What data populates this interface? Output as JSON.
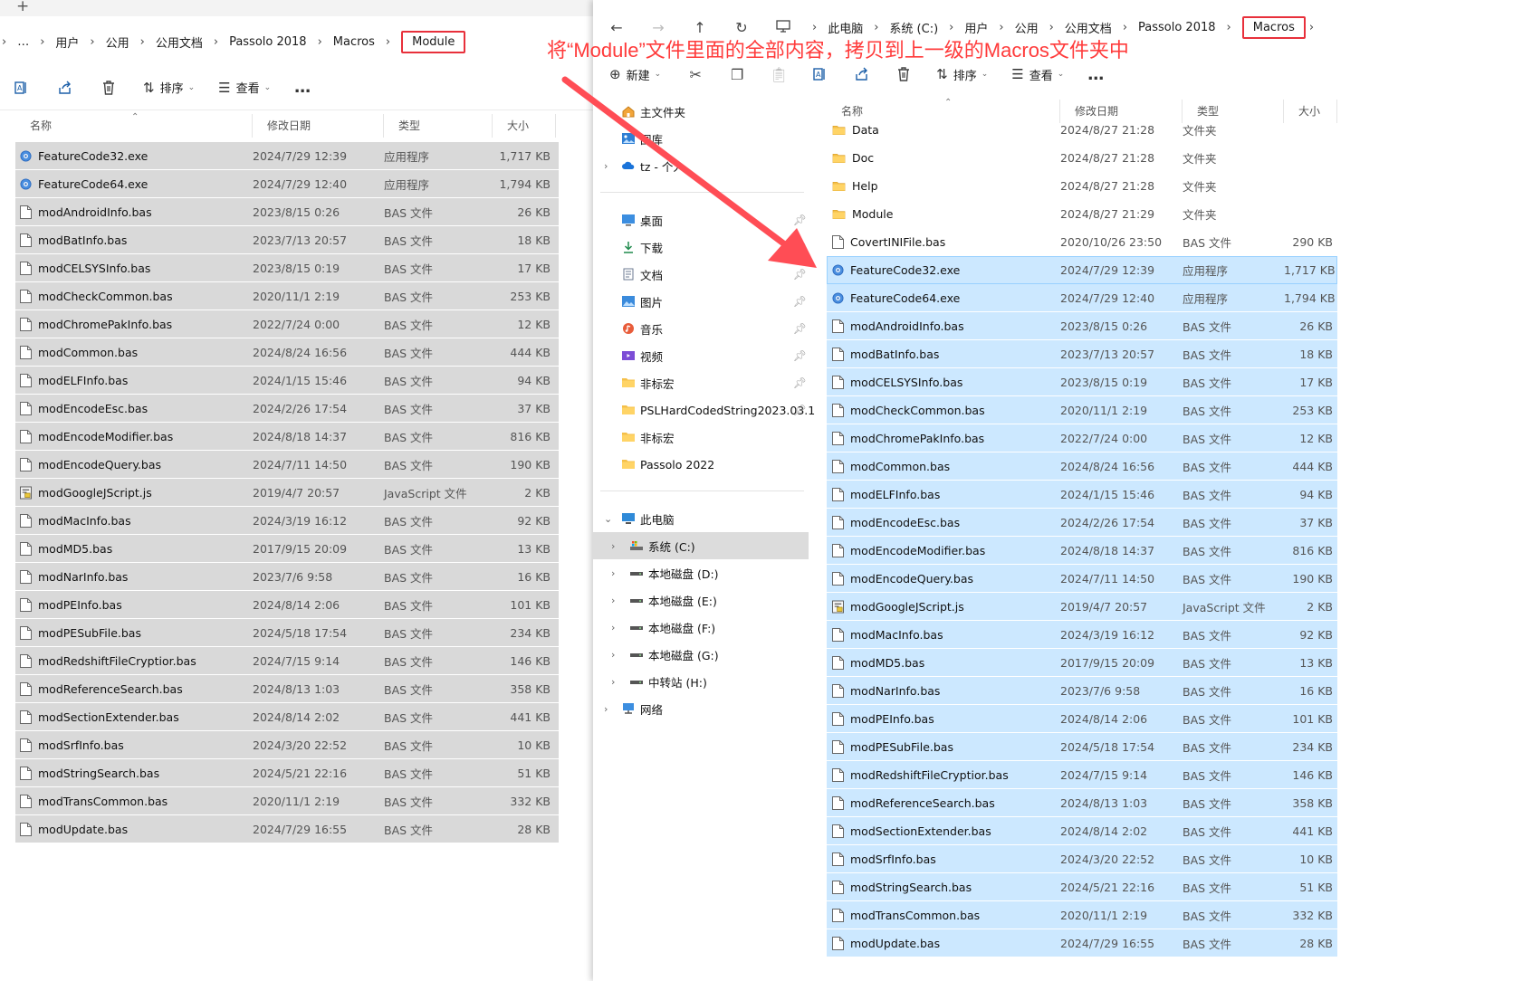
{
  "annotation": {
    "text": "将“Module”文件里面的全部内容，拷贝到上一级的Macros文件夹中",
    "color": "#ff3b3b"
  },
  "left": {
    "tab_plus": "+",
    "breadcrumb": {
      "more": "…",
      "items": [
        "用户",
        "公用",
        "公用文档",
        "Passolo 2018",
        "Macros"
      ],
      "current": "Module"
    },
    "toolbar": {
      "sort": "排序",
      "view": "查看",
      "more": "…"
    },
    "columns": {
      "name": "名称",
      "date": "修改日期",
      "type": "类型",
      "size": "大小"
    },
    "files": [
      {
        "name": "FeatureCode32.exe",
        "date": "2024/7/29 12:39",
        "type": "应用程序",
        "size": "1,717 KB",
        "icon": "exe-icon"
      },
      {
        "name": "FeatureCode64.exe",
        "date": "2024/7/29 12:40",
        "type": "应用程序",
        "size": "1,794 KB",
        "icon": "exe-icon"
      },
      {
        "name": "modAndroidInfo.bas",
        "date": "2023/8/15 0:26",
        "type": "BAS 文件",
        "size": "26 KB",
        "icon": "file-icon"
      },
      {
        "name": "modBatInfo.bas",
        "date": "2023/7/13 20:57",
        "type": "BAS 文件",
        "size": "18 KB",
        "icon": "file-icon"
      },
      {
        "name": "modCELSYSInfo.bas",
        "date": "2023/8/15 0:19",
        "type": "BAS 文件",
        "size": "17 KB",
        "icon": "file-icon"
      },
      {
        "name": "modCheckCommon.bas",
        "date": "2020/11/1 2:19",
        "type": "BAS 文件",
        "size": "253 KB",
        "icon": "file-icon"
      },
      {
        "name": "modChromePakInfo.bas",
        "date": "2022/7/24 0:00",
        "type": "BAS 文件",
        "size": "12 KB",
        "icon": "file-icon"
      },
      {
        "name": "modCommon.bas",
        "date": "2024/8/24 16:56",
        "type": "BAS 文件",
        "size": "444 KB",
        "icon": "file-icon"
      },
      {
        "name": "modELFInfo.bas",
        "date": "2024/1/15 15:46",
        "type": "BAS 文件",
        "size": "94 KB",
        "icon": "file-icon"
      },
      {
        "name": "modEncodeEsc.bas",
        "date": "2024/2/26 17:54",
        "type": "BAS 文件",
        "size": "37 KB",
        "icon": "file-icon"
      },
      {
        "name": "modEncodeModifier.bas",
        "date": "2024/8/18 14:37",
        "type": "BAS 文件",
        "size": "816 KB",
        "icon": "file-icon"
      },
      {
        "name": "modEncodeQuery.bas",
        "date": "2024/7/11 14:50",
        "type": "BAS 文件",
        "size": "190 KB",
        "icon": "file-icon"
      },
      {
        "name": "modGoogleJScript.js",
        "date": "2019/4/7 20:57",
        "type": "JavaScript 文件",
        "size": "2 KB",
        "icon": "js-icon"
      },
      {
        "name": "modMacInfo.bas",
        "date": "2024/3/19 16:12",
        "type": "BAS 文件",
        "size": "92 KB",
        "icon": "file-icon"
      },
      {
        "name": "modMD5.bas",
        "date": "2017/9/15 20:09",
        "type": "BAS 文件",
        "size": "13 KB",
        "icon": "file-icon"
      },
      {
        "name": "modNarInfo.bas",
        "date": "2023/7/6 9:58",
        "type": "BAS 文件",
        "size": "16 KB",
        "icon": "file-icon"
      },
      {
        "name": "modPEInfo.bas",
        "date": "2024/8/14 2:06",
        "type": "BAS 文件",
        "size": "101 KB",
        "icon": "file-icon"
      },
      {
        "name": "modPESubFile.bas",
        "date": "2024/5/18 17:54",
        "type": "BAS 文件",
        "size": "234 KB",
        "icon": "file-icon"
      },
      {
        "name": "modRedshiftFileCryptior.bas",
        "date": "2024/7/15 9:14",
        "type": "BAS 文件",
        "size": "146 KB",
        "icon": "file-icon"
      },
      {
        "name": "modReferenceSearch.bas",
        "date": "2024/8/13 1:03",
        "type": "BAS 文件",
        "size": "358 KB",
        "icon": "file-icon"
      },
      {
        "name": "modSectionExtender.bas",
        "date": "2024/8/14 2:02",
        "type": "BAS 文件",
        "size": "441 KB",
        "icon": "file-icon"
      },
      {
        "name": "modSrfInfo.bas",
        "date": "2024/3/20 22:52",
        "type": "BAS 文件",
        "size": "10 KB",
        "icon": "file-icon"
      },
      {
        "name": "modStringSearch.bas",
        "date": "2024/5/21 22:16",
        "type": "BAS 文件",
        "size": "51 KB",
        "icon": "file-icon"
      },
      {
        "name": "modTransCommon.bas",
        "date": "2020/11/1 2:19",
        "type": "BAS 文件",
        "size": "332 KB",
        "icon": "file-icon"
      },
      {
        "name": "modUpdate.bas",
        "date": "2024/7/29 16:55",
        "type": "BAS 文件",
        "size": "28 KB",
        "icon": "file-icon"
      }
    ]
  },
  "right": {
    "breadcrumb": {
      "items": [
        "此电脑",
        "系统 (C:)",
        "用户",
        "公用",
        "公用文档",
        "Passolo 2018"
      ],
      "current": "Macros"
    },
    "toolbar": {
      "new": "新建",
      "sort": "排序",
      "view": "查看",
      "more": "…"
    },
    "columns": {
      "name": "名称",
      "date": "修改日期",
      "type": "类型",
      "size": "大小"
    },
    "nav": {
      "quick": [
        {
          "label": "主文件夹",
          "icon": "home-icon",
          "chevron": false
        },
        {
          "label": "图库",
          "icon": "gallery-icon",
          "chevron": false
        },
        {
          "label": "tz - 个人",
          "icon": "cloud-icon",
          "chevron": true
        }
      ],
      "pinned": [
        {
          "label": "桌面",
          "icon": "desktop-icon",
          "pin": true
        },
        {
          "label": "下载",
          "icon": "download-icon",
          "pin": true
        },
        {
          "label": "文档",
          "icon": "document-icon",
          "pin": true
        },
        {
          "label": "图片",
          "icon": "picture-icon",
          "pin": true
        },
        {
          "label": "音乐",
          "icon": "music-icon",
          "pin": true
        },
        {
          "label": "视频",
          "icon": "video-icon",
          "pin": true
        },
        {
          "label": "非标宏",
          "icon": "folder-icon",
          "pin": true
        },
        {
          "label": "PSLHardCodedString2023.03.1",
          "icon": "folder-icon",
          "pin": true
        },
        {
          "label": "非标宏",
          "icon": "folder-icon",
          "pin": false
        },
        {
          "label": "Passolo 2022",
          "icon": "folder-icon",
          "pin": false
        }
      ],
      "pc": {
        "label": "此电脑",
        "icon": "pc-icon"
      },
      "drives": [
        {
          "label": "系统 (C:)",
          "icon": "system-drive-icon",
          "selected": true
        },
        {
          "label": "本地磁盘 (D:)",
          "icon": "drive-icon",
          "selected": false
        },
        {
          "label": "本地磁盘 (E:)",
          "icon": "drive-icon",
          "selected": false
        },
        {
          "label": "本地磁盘 (F:)",
          "icon": "drive-icon",
          "selected": false
        },
        {
          "label": "本地磁盘 (G:)",
          "icon": "drive-icon",
          "selected": false
        },
        {
          "label": "中转站 (H:)",
          "icon": "drive-icon",
          "selected": false
        }
      ],
      "network": {
        "label": "网络",
        "icon": "network-icon"
      }
    },
    "files": [
      {
        "name": "Data",
        "date": "2024/8/27 21:28",
        "type": "文件夹",
        "size": "",
        "icon": "folder-icon",
        "selected": false
      },
      {
        "name": "Doc",
        "date": "2024/8/27 21:28",
        "type": "文件夹",
        "size": "",
        "icon": "folder-icon",
        "selected": false
      },
      {
        "name": "Help",
        "date": "2024/8/27 21:28",
        "type": "文件夹",
        "size": "",
        "icon": "folder-icon",
        "selected": false
      },
      {
        "name": "Module",
        "date": "2024/8/27 21:29",
        "type": "文件夹",
        "size": "",
        "icon": "folder-icon",
        "selected": false
      },
      {
        "name": "CovertINIFile.bas",
        "date": "2020/10/26 23:50",
        "type": "BAS 文件",
        "size": "290 KB",
        "icon": "file-icon",
        "selected": false
      },
      {
        "name": "FeatureCode32.exe",
        "date": "2024/7/29 12:39",
        "type": "应用程序",
        "size": "1,717 KB",
        "icon": "exe-icon",
        "selected": true
      },
      {
        "name": "FeatureCode64.exe",
        "date": "2024/7/29 12:40",
        "type": "应用程序",
        "size": "1,794 KB",
        "icon": "exe-icon",
        "selected": true
      },
      {
        "name": "modAndroidInfo.bas",
        "date": "2023/8/15 0:26",
        "type": "BAS 文件",
        "size": "26 KB",
        "icon": "file-icon",
        "selected": true
      },
      {
        "name": "modBatInfo.bas",
        "date": "2023/7/13 20:57",
        "type": "BAS 文件",
        "size": "18 KB",
        "icon": "file-icon",
        "selected": true
      },
      {
        "name": "modCELSYSInfo.bas",
        "date": "2023/8/15 0:19",
        "type": "BAS 文件",
        "size": "17 KB",
        "icon": "file-icon",
        "selected": true
      },
      {
        "name": "modCheckCommon.bas",
        "date": "2020/11/1 2:19",
        "type": "BAS 文件",
        "size": "253 KB",
        "icon": "file-icon",
        "selected": true
      },
      {
        "name": "modChromePakInfo.bas",
        "date": "2022/7/24 0:00",
        "type": "BAS 文件",
        "size": "12 KB",
        "icon": "file-icon",
        "selected": true
      },
      {
        "name": "modCommon.bas",
        "date": "2024/8/24 16:56",
        "type": "BAS 文件",
        "size": "444 KB",
        "icon": "file-icon",
        "selected": true
      },
      {
        "name": "modELFInfo.bas",
        "date": "2024/1/15 15:46",
        "type": "BAS 文件",
        "size": "94 KB",
        "icon": "file-icon",
        "selected": true
      },
      {
        "name": "modEncodeEsc.bas",
        "date": "2024/2/26 17:54",
        "type": "BAS 文件",
        "size": "37 KB",
        "icon": "file-icon",
        "selected": true
      },
      {
        "name": "modEncodeModifier.bas",
        "date": "2024/8/18 14:37",
        "type": "BAS 文件",
        "size": "816 KB",
        "icon": "file-icon",
        "selected": true
      },
      {
        "name": "modEncodeQuery.bas",
        "date": "2024/7/11 14:50",
        "type": "BAS 文件",
        "size": "190 KB",
        "icon": "file-icon",
        "selected": true
      },
      {
        "name": "modGoogleJScript.js",
        "date": "2019/4/7 20:57",
        "type": "JavaScript 文件",
        "size": "2 KB",
        "icon": "js-icon",
        "selected": true
      },
      {
        "name": "modMacInfo.bas",
        "date": "2024/3/19 16:12",
        "type": "BAS 文件",
        "size": "92 KB",
        "icon": "file-icon",
        "selected": true
      },
      {
        "name": "modMD5.bas",
        "date": "2017/9/15 20:09",
        "type": "BAS 文件",
        "size": "13 KB",
        "icon": "file-icon",
        "selected": true
      },
      {
        "name": "modNarInfo.bas",
        "date": "2023/7/6 9:58",
        "type": "BAS 文件",
        "size": "16 KB",
        "icon": "file-icon",
        "selected": true
      },
      {
        "name": "modPEInfo.bas",
        "date": "2024/8/14 2:06",
        "type": "BAS 文件",
        "size": "101 KB",
        "icon": "file-icon",
        "selected": true
      },
      {
        "name": "modPESubFile.bas",
        "date": "2024/5/18 17:54",
        "type": "BAS 文件",
        "size": "234 KB",
        "icon": "file-icon",
        "selected": true
      },
      {
        "name": "modRedshiftFileCryptior.bas",
        "date": "2024/7/15 9:14",
        "type": "BAS 文件",
        "size": "146 KB",
        "icon": "file-icon",
        "selected": true
      },
      {
        "name": "modReferenceSearch.bas",
        "date": "2024/8/13 1:03",
        "type": "BAS 文件",
        "size": "358 KB",
        "icon": "file-icon",
        "selected": true
      },
      {
        "name": "modSectionExtender.bas",
        "date": "2024/8/14 2:02",
        "type": "BAS 文件",
        "size": "441 KB",
        "icon": "file-icon",
        "selected": true
      },
      {
        "name": "modSrfInfo.bas",
        "date": "2024/3/20 22:52",
        "type": "BAS 文件",
        "size": "10 KB",
        "icon": "file-icon",
        "selected": true
      },
      {
        "name": "modStringSearch.bas",
        "date": "2024/5/21 22:16",
        "type": "BAS 文件",
        "size": "51 KB",
        "icon": "file-icon",
        "selected": true
      },
      {
        "name": "modTransCommon.bas",
        "date": "2020/11/1 2:19",
        "type": "BAS 文件",
        "size": "332 KB",
        "icon": "file-icon",
        "selected": true
      },
      {
        "name": "modUpdate.bas",
        "date": "2024/7/29 16:55",
        "type": "BAS 文件",
        "size": "28 KB",
        "icon": "file-icon",
        "selected": true
      }
    ]
  },
  "colors": {
    "highlight": "#e8303b",
    "selection": "#cce8ff",
    "left_selection": "#d9d9d9",
    "folder": "#f5c04a"
  }
}
